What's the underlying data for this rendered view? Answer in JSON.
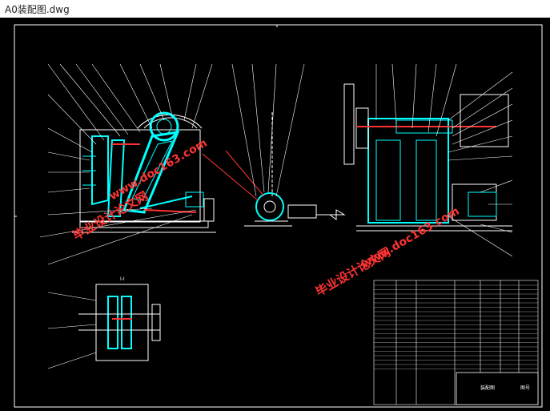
{
  "window": {
    "title": "A0装配图.dwg"
  },
  "drawing": {
    "background": "#000000",
    "colors": {
      "frame": "#ffffff",
      "machine": "#00ffff",
      "accent": "#ff3333",
      "leader": "#ffffff",
      "dim": "#ffff00"
    },
    "detail_label": "I-I",
    "title_block_label": "装配图",
    "sheet_label": "图号"
  },
  "watermarks": [
    {
      "text": "毕业设计论文网",
      "color": "#ff3333"
    },
    {
      "text": "www.doc163.com",
      "color": "#ff3333"
    },
    {
      "text": "毕业设计论文网",
      "color": "#ff3333"
    },
    {
      "text": "www.doc163.com",
      "color": "#ff3333"
    }
  ]
}
